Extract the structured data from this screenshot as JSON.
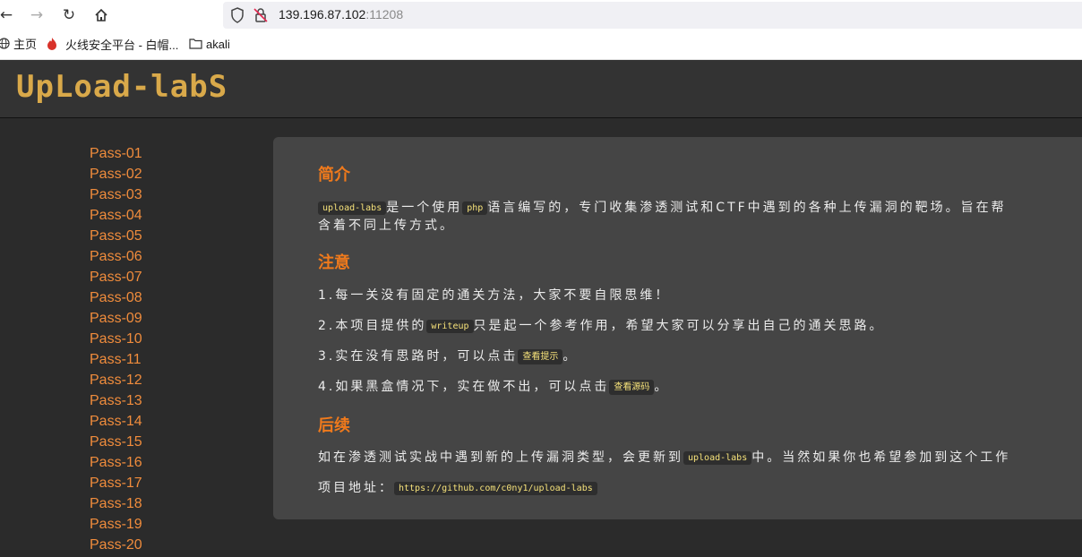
{
  "browser": {
    "url_host": "139.196.87.102",
    "url_port": ":11208",
    "bookmarks": [
      "主页",
      "火线安全平台 - 白帽...",
      "akali"
    ]
  },
  "site": {
    "logo": "UpLoad-labS"
  },
  "sidebar": {
    "items": [
      "Pass-01",
      "Pass-02",
      "Pass-03",
      "Pass-04",
      "Pass-05",
      "Pass-06",
      "Pass-07",
      "Pass-08",
      "Pass-09",
      "Pass-10",
      "Pass-11",
      "Pass-12",
      "Pass-13",
      "Pass-14",
      "Pass-15",
      "Pass-16",
      "Pass-17",
      "Pass-18",
      "Pass-19",
      "Pass-20"
    ]
  },
  "main": {
    "intro_heading": "简介",
    "intro_code1": "upload-labs",
    "intro_text1": "是一个使用",
    "intro_code2": "php",
    "intro_text2": "语言编写的，专门收集渗透测试和CTF中遇到的各种上传漏洞的靶场。旨在帮",
    "intro_text3": "含着不同上传方式。",
    "notice_heading": "注意",
    "notice1": "1.每一关没有固定的通关方法，大家不要自限思维！",
    "notice2_pre": "2.本项目提供的",
    "notice2_code": "writeup",
    "notice2_post": "只是起一个参考作用，希望大家可以分享出自己的通关思路。",
    "notice3_pre": "3.实在没有思路时，可以点击",
    "notice3_btn": "查看提示",
    "notice3_post": "。",
    "notice4_pre": "4.如果黑盒情况下，实在做不出，可以点击",
    "notice4_btn": "查看源码",
    "notice4_post": "。",
    "followup_heading": "后续",
    "followup_pre": "如在渗透测试实战中遇到新的上传漏洞类型，会更新到",
    "followup_code": "upload-labs",
    "followup_post": "中。当然如果你也希望参加到这个工作",
    "project_label": "项目地址：",
    "project_url": "https://github.com/c0ny1/upload-labs"
  }
}
